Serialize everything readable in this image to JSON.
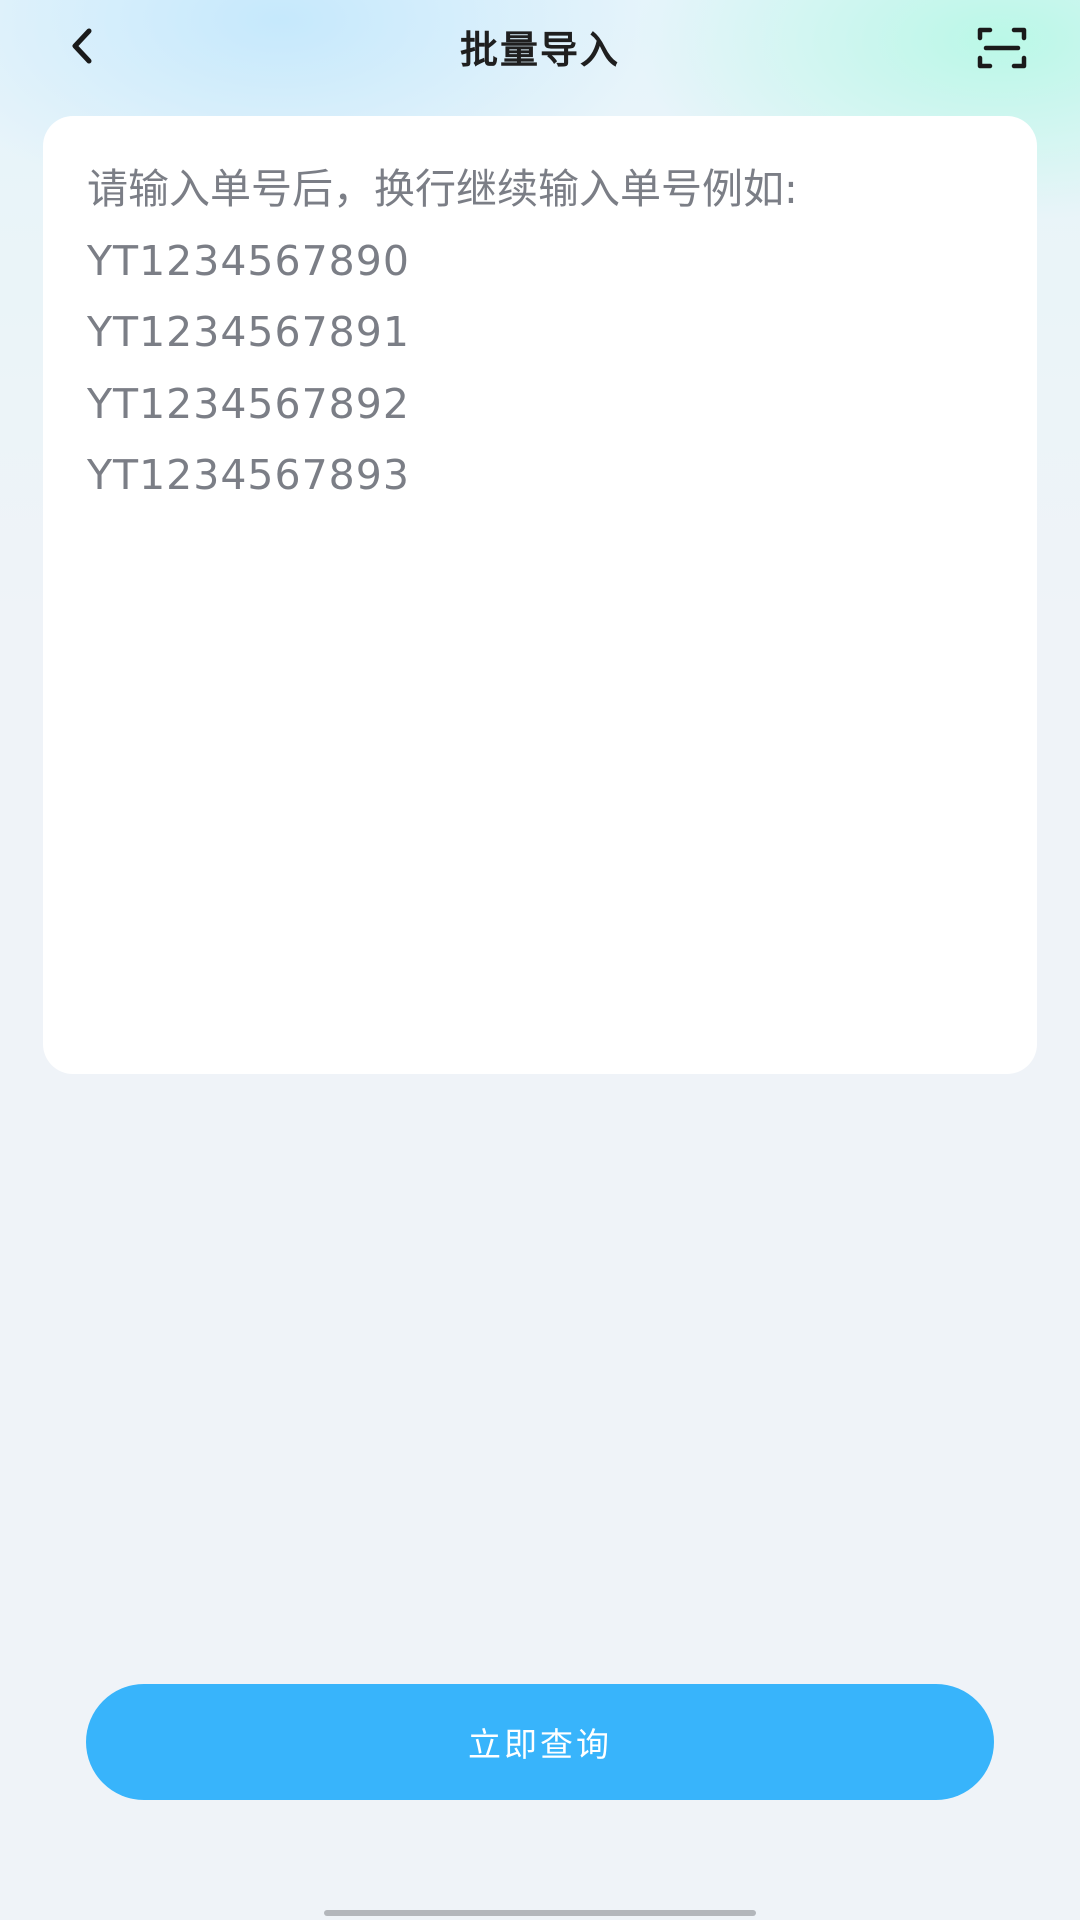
{
  "header": {
    "title": "批量导入",
    "back_icon": "chevron-left-icon",
    "scan_icon": "scan-icon"
  },
  "input": {
    "placeholder_line": "请输入单号后，换行继续输入单号例如:",
    "example_numbers": [
      "YT1234567890",
      "YT1234567891",
      "YT1234567892",
      "YT1234567893"
    ]
  },
  "actions": {
    "query_label": "立即查询"
  },
  "colors": {
    "primary": "#38b4fb",
    "page_bg": "#eff3f8",
    "card_bg": "#ffffff",
    "placeholder_text": "#7b7e86",
    "title_text": "#1f1f1f"
  }
}
